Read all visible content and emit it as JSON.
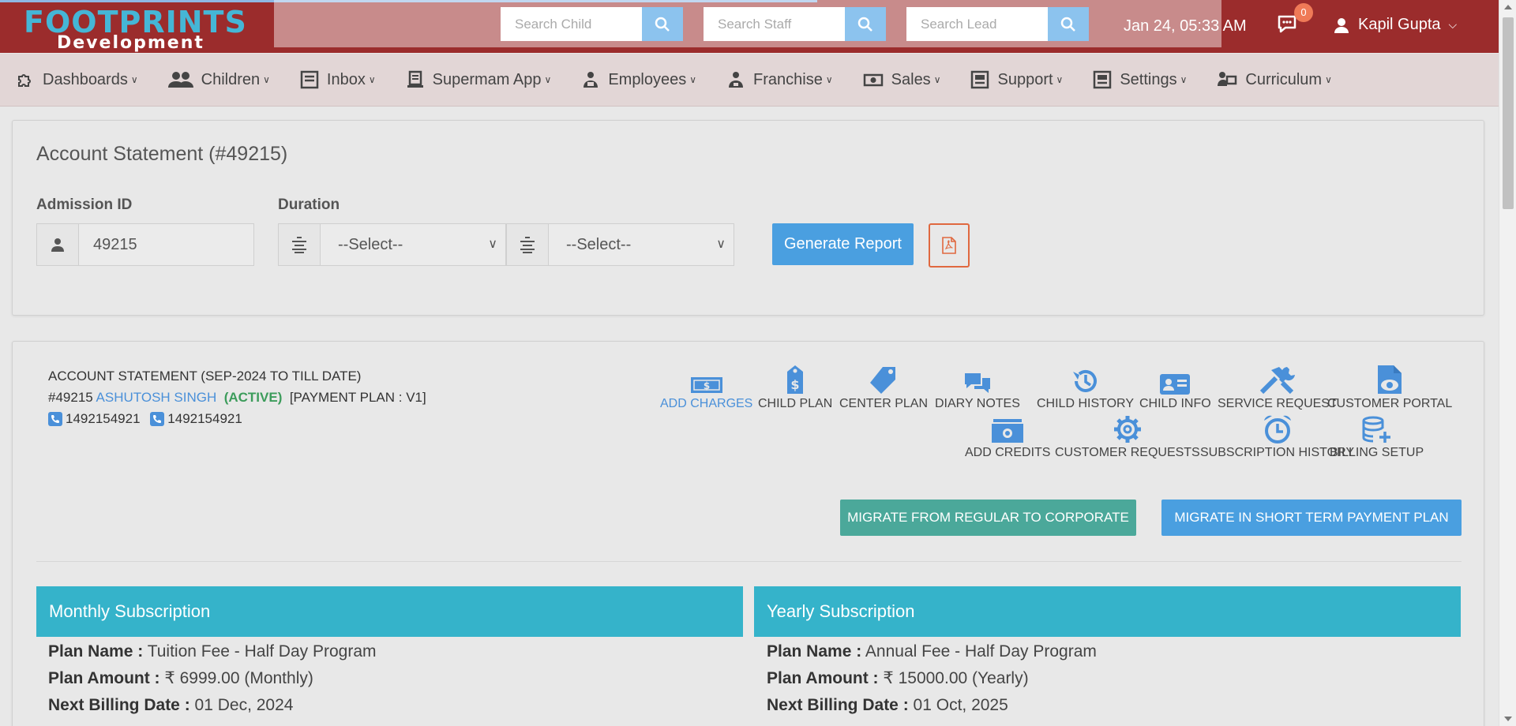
{
  "header": {
    "brand": "FOOTPRINTS",
    "brand_sub": "Development",
    "search_child_placeholder": "Search Child",
    "search_staff_placeholder": "Search Staff",
    "search_lead_placeholder": "Search Lead",
    "datetime": "Jan 24, 05:33 AM",
    "notification_count": "0",
    "user_name": "Kapil Gupta"
  },
  "nav": {
    "items": [
      {
        "label": "Dashboards",
        "icon": "puzzle-icon"
      },
      {
        "label": "Children",
        "icon": "users-icon"
      },
      {
        "label": "Inbox",
        "icon": "inbox-icon"
      },
      {
        "label": "Supermam App",
        "icon": "app-icon"
      },
      {
        "label": "Employees",
        "icon": "employee-icon"
      },
      {
        "label": "Franchise",
        "icon": "franchise-icon"
      },
      {
        "label": "Sales",
        "icon": "money-icon"
      },
      {
        "label": "Support",
        "icon": "support-icon"
      },
      {
        "label": "Settings",
        "icon": "settings-icon"
      },
      {
        "label": "Curriculum",
        "icon": "curriculum-icon"
      }
    ]
  },
  "statement_form": {
    "title": "Account Statement (#49215)",
    "admission_label": "Admission ID",
    "admission_value": "49215",
    "duration_label": "Duration",
    "select_from": "--Select--",
    "select_to": "--Select--",
    "generate_label": "Generate Report"
  },
  "statement": {
    "heading": "ACCOUNT STATEMENT (SEP-2024 TO TILL DATE)",
    "id": "#49215",
    "child_name": "ASHUTOSH SINGH",
    "status": "(ACTIVE)",
    "payment_plan": "[PAYMENT PLAN : V1]",
    "phone1": "1492154921",
    "phone2": "1492154921",
    "actions_row1": [
      "ADD CHARGES",
      "CHILD PLAN",
      "CENTER PLAN",
      "DIARY NOTES",
      "CHILD HISTORY",
      "CHILD INFO",
      "SERVICE REQUEST",
      "CUSTOMER PORTAL"
    ],
    "actions_row2": [
      "ADD CREDITS",
      "CUSTOMER REQUESTS",
      "SUBSCRIPTION HISTORY",
      "BILLING SETUP"
    ],
    "migrate_corporate": "MIGRATE FROM REGULAR TO CORPORATE",
    "migrate_short": "MIGRATE IN SHORT TERM PAYMENT PLAN"
  },
  "monthly": {
    "title": "Monthly Subscription",
    "plan_name_label": "Plan Name :",
    "plan_name": "Tuition Fee - Half Day Program",
    "plan_amount_label": "Plan Amount :",
    "plan_amount": "₹ 6999.00 (Monthly)",
    "next_billing_label": "Next Billing Date :",
    "next_billing": "01 Dec, 2024"
  },
  "yearly": {
    "title": "Yearly Subscription",
    "plan_name_label": "Plan Name :",
    "plan_name": "Annual Fee - Half Day Program",
    "plan_amount_label": "Plan Amount :",
    "plan_amount": "₹ 15000.00 (Yearly)",
    "next_billing_label": "Next Billing Date :",
    "next_billing": "01 Oct, 2025"
  },
  "colors": {
    "topbar": "#9b2c2c",
    "accent_blue": "#4a9fe0",
    "teal_header": "#35b3ca",
    "green_button": "#4ba89a"
  }
}
